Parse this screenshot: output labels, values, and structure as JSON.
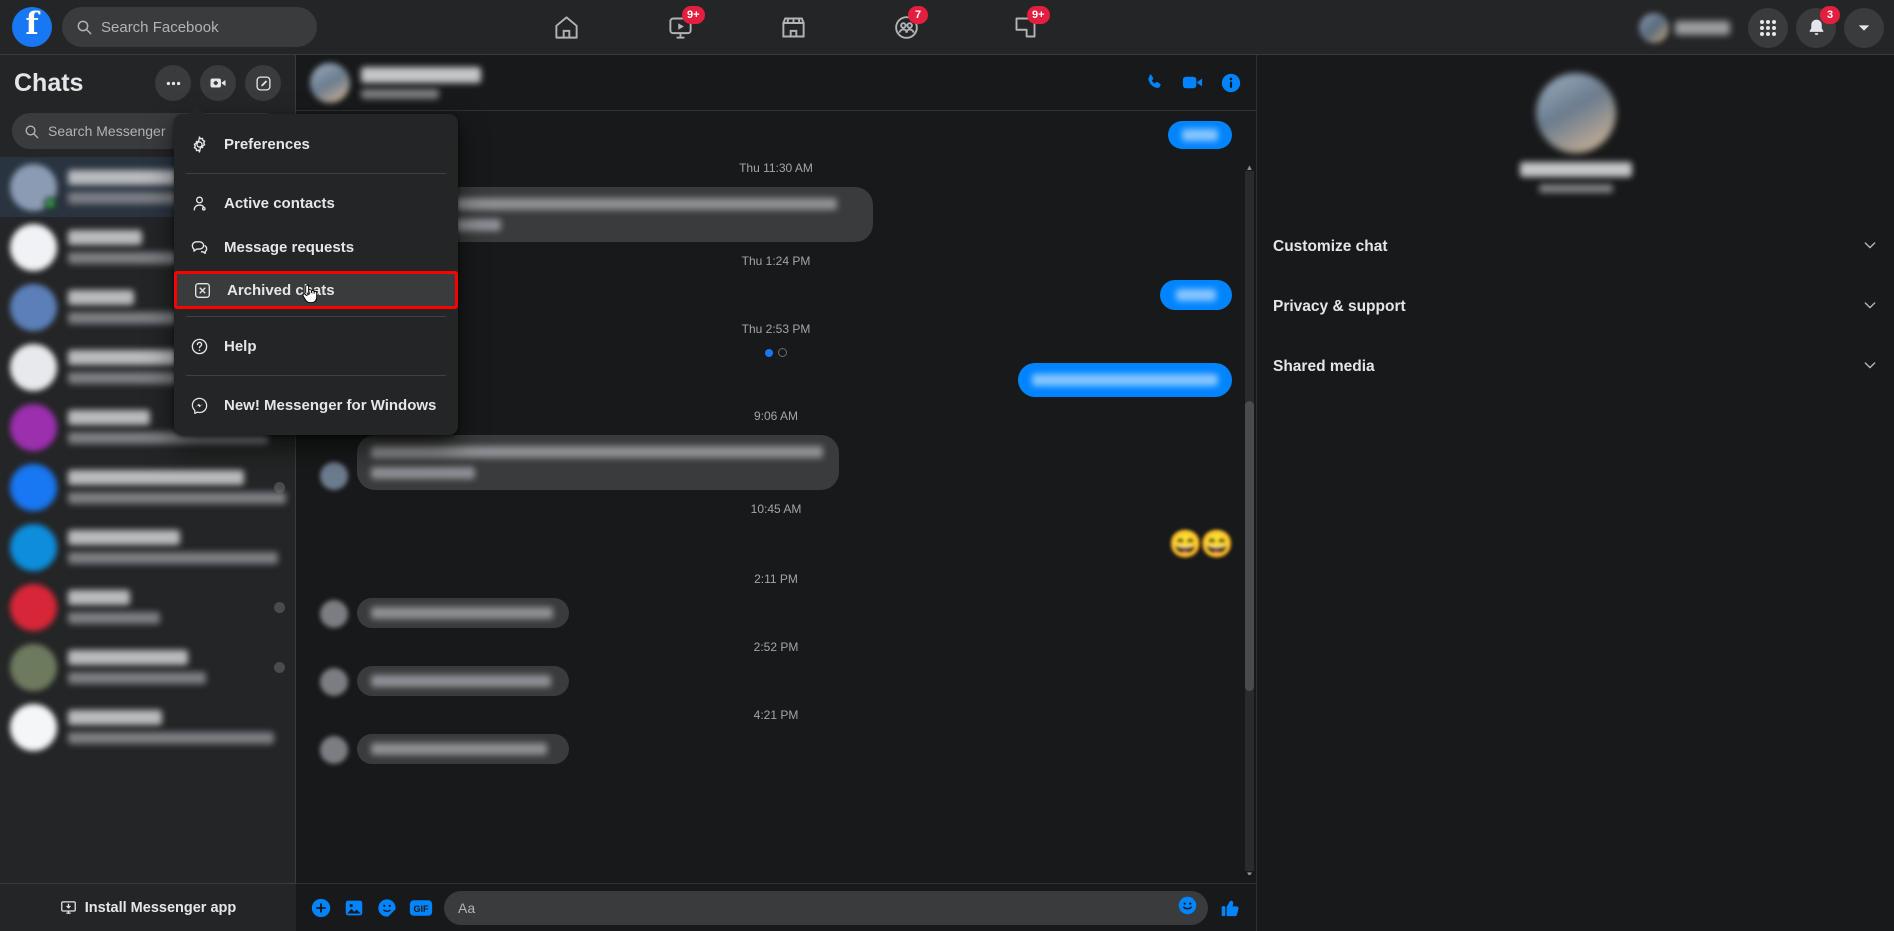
{
  "topbar": {
    "logo": "facebook-logo",
    "search": {
      "placeholder": "Search Facebook",
      "icon": "search-icon"
    },
    "nav": [
      {
        "name": "home",
        "icon": "home-icon",
        "badge": null
      },
      {
        "name": "video",
        "icon": "video-icon",
        "badge": "9+"
      },
      {
        "name": "marketplace",
        "icon": "marketplace-icon",
        "badge": null
      },
      {
        "name": "groups",
        "icon": "groups-icon",
        "badge": "7"
      },
      {
        "name": "gaming",
        "icon": "gaming-icon",
        "badge": "9+"
      }
    ],
    "menu_grid_icon": "grid-menu-icon",
    "notifications": {
      "icon": "bell-icon",
      "badge": "3"
    },
    "account_icon": "chevron-down-icon"
  },
  "sidebar": {
    "title": "Chats",
    "actions": [
      {
        "name": "options",
        "icon": "ellipsis-icon"
      },
      {
        "name": "new-video-room",
        "icon": "video-plus-icon"
      },
      {
        "name": "new-message",
        "icon": "compose-icon"
      }
    ],
    "search": {
      "placeholder": "Search Messenger",
      "icon": "search-icon"
    },
    "install": {
      "label": "Install Messenger app",
      "icon": "monitor-download-icon"
    }
  },
  "menu": {
    "items": [
      {
        "label": "Preferences",
        "icon": "gear-icon",
        "highlighted": false
      },
      {
        "label": "Active contacts",
        "icon": "person-icon",
        "highlighted": false
      },
      {
        "label": "Message requests",
        "icon": "chat-bubbles-icon",
        "highlighted": false
      },
      {
        "label": "Archived chats",
        "icon": "archive-x-icon",
        "highlighted": true
      },
      {
        "label": "Help",
        "icon": "question-circle-icon",
        "highlighted": false
      },
      {
        "label": "New! Messenger for Windows",
        "icon": "messenger-icon",
        "highlighted": false
      }
    ],
    "highlight_color": "#ff0000",
    "cursor": "hand-pointer"
  },
  "conversation": {
    "header_actions": [
      {
        "name": "audio-call",
        "icon": "phone-icon"
      },
      {
        "name": "video-call",
        "icon": "video-camera-icon"
      },
      {
        "name": "conversation-info",
        "icon": "info-icon"
      }
    ],
    "timestamps": [
      "Thu 11:30 AM",
      "Thu 1:24 PM",
      "Thu 2:53 PM",
      "9:06 AM",
      "10:45 AM",
      "2:11 PM",
      "2:52 PM",
      "4:21 PM"
    ],
    "composer": {
      "placeholder": "Aa",
      "actions": [
        {
          "name": "add-attachment",
          "icon": "plus-circle-icon"
        },
        {
          "name": "attach-photo",
          "icon": "photo-icon"
        },
        {
          "name": "attach-sticker",
          "icon": "sticker-icon"
        },
        {
          "name": "attach-gif",
          "icon": "gif-icon"
        }
      ],
      "emoji_icon": "emoji-smiley-icon",
      "like_icon": "thumbs-up-icon"
    }
  },
  "right_panel": {
    "sections": [
      {
        "label": "Customize chat",
        "icon": "chevron-down-icon"
      },
      {
        "label": "Privacy & support",
        "icon": "chevron-down-icon"
      },
      {
        "label": "Shared media",
        "icon": "chevron-down-icon"
      }
    ]
  },
  "colors": {
    "accent": "#0084ff",
    "badge": "#e41e3f",
    "online": "#31a24c",
    "highlight": "#ff0000",
    "surface": "#242526",
    "background": "#18191a"
  },
  "chat_list": [
    {
      "avatar": "#8b9bb4",
      "active": true,
      "online": true,
      "unread": false,
      "name_w": 118,
      "snip_w": 190
    },
    {
      "avatar": "#f0f2f5",
      "active": false,
      "online": false,
      "unread": true,
      "name_w": 74,
      "snip_w": 172
    },
    {
      "avatar": "#5b7fb8",
      "active": false,
      "online": false,
      "unread": false,
      "name_w": 66,
      "snip_w": 118
    },
    {
      "avatar": "#e8e9ed",
      "active": false,
      "online": false,
      "unread": false,
      "name_w": 146,
      "snip_w": 214
    },
    {
      "avatar": "#9b2fae",
      "active": false,
      "online": false,
      "unread": false,
      "name_w": 82,
      "snip_w": 200
    },
    {
      "avatar": "#1877f2",
      "active": false,
      "online": false,
      "unread": true,
      "name_w": 176,
      "snip_w": 218
    },
    {
      "avatar": "#0d8ddb",
      "active": false,
      "online": false,
      "unread": false,
      "name_w": 112,
      "snip_w": 210
    },
    {
      "avatar": "#d72638",
      "active": false,
      "online": false,
      "unread": true,
      "name_w": 62,
      "snip_w": 92
    },
    {
      "avatar": "#6d7a5e",
      "active": false,
      "online": false,
      "unread": true,
      "name_w": 120,
      "snip_w": 138
    },
    {
      "avatar": "#f5f6f8",
      "active": false,
      "online": false,
      "unread": false,
      "name_w": 94,
      "snip_w": 206
    }
  ]
}
